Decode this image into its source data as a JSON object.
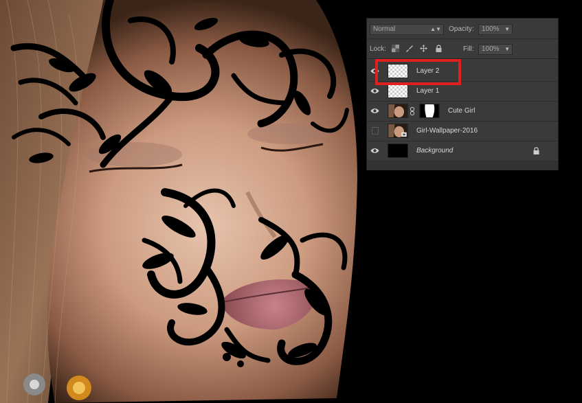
{
  "panel": {
    "blend_mode": "Normal",
    "opacity_label": "Opacity:",
    "opacity_value": "100%",
    "lock_label": "Lock:",
    "fill_label": "Fill:",
    "fill_value": "100%",
    "layers": [
      {
        "name": "Layer 2",
        "visible": true,
        "thumb": "checker",
        "highlighted": true
      },
      {
        "name": "Layer 1",
        "visible": true,
        "thumb": "checker"
      },
      {
        "name": "Cute Girl",
        "visible": true,
        "thumb": "photo",
        "has_mask": true
      },
      {
        "name": "Girl-Wallpaper-2016",
        "visible": false,
        "thumb": "photo-smart"
      },
      {
        "name": "Background",
        "visible": true,
        "thumb": "black",
        "locked": true
      }
    ]
  },
  "colors": {
    "panel_bg": "#3a3a3a",
    "highlight": "#e02020",
    "ornament": "#000000"
  }
}
